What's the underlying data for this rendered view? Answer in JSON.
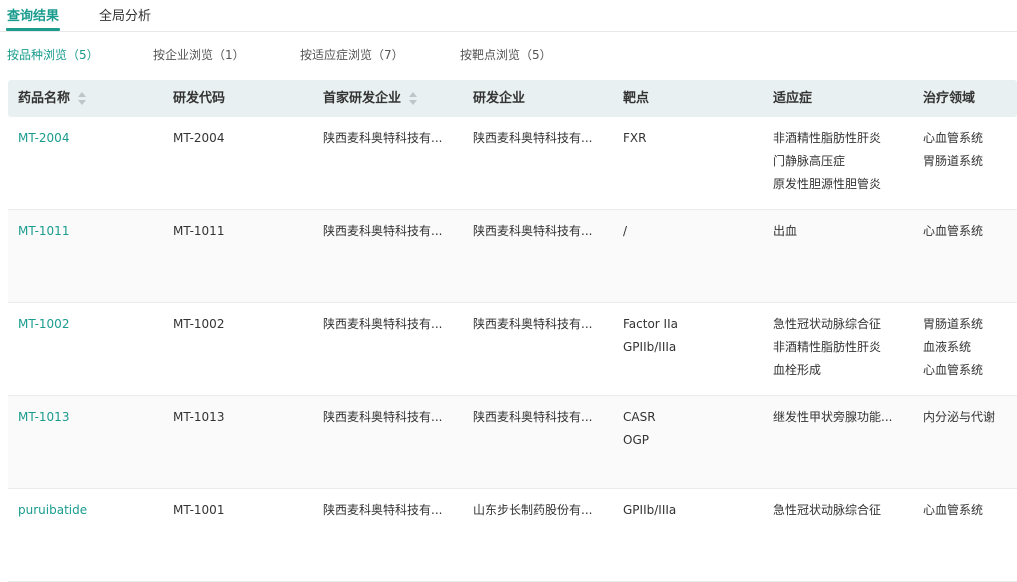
{
  "tabs": [
    "查询结果",
    "全局分析"
  ],
  "subtabs": [
    "按品种浏览（5）",
    "按企业浏览（1）",
    "按适应症浏览（7）",
    "按靶点浏览（5）"
  ],
  "columns": [
    "药品名称",
    "研发代码",
    "首家研发企业",
    "研发企业",
    "靶点",
    "适应症",
    "治疗领域"
  ],
  "rows": [
    {
      "name": "MT-2004",
      "code": "MT-2004",
      "first_company": "陕西麦科奥特科技有...",
      "company": "陕西麦科奥特科技有...",
      "targets": [
        "FXR"
      ],
      "indications": [
        "非酒精性脂肪性肝炎",
        "门静脉高压症",
        "原发性胆源性胆管炎"
      ],
      "areas": [
        "心血管系统",
        "胃肠道系统"
      ]
    },
    {
      "name": "MT-1011",
      "code": "MT-1011",
      "first_company": "陕西麦科奥特科技有...",
      "company": "陕西麦科奥特科技有...",
      "targets": [
        "/"
      ],
      "indications": [
        "出血"
      ],
      "areas": [
        "心血管系统"
      ]
    },
    {
      "name": "MT-1002",
      "code": "MT-1002",
      "first_company": "陕西麦科奥特科技有...",
      "company": "陕西麦科奥特科技有...",
      "targets": [
        "Factor IIa",
        "GPIIb/IIIa"
      ],
      "indications": [
        "急性冠状动脉综合征",
        "非酒精性脂肪性肝炎",
        "血栓形成"
      ],
      "areas": [
        "胃肠道系统",
        "血液系统",
        "心血管系统"
      ]
    },
    {
      "name": "MT-1013",
      "code": "MT-1013",
      "first_company": "陕西麦科奥特科技有...",
      "company": "陕西麦科奥特科技有...",
      "targets": [
        "CASR",
        "OGP"
      ],
      "indications": [
        "继发性甲状旁腺功能..."
      ],
      "areas": [
        "内分泌与代谢"
      ]
    },
    {
      "name": "puruibatide",
      "code": "MT-1001",
      "first_company": "陕西麦科奥特科技有...",
      "company": "山东步长制药股份有...",
      "targets": [
        "GPIIb/IIIa"
      ],
      "indications": [
        "急性冠状动脉综合征"
      ],
      "areas": [
        "心血管系统"
      ]
    }
  ]
}
